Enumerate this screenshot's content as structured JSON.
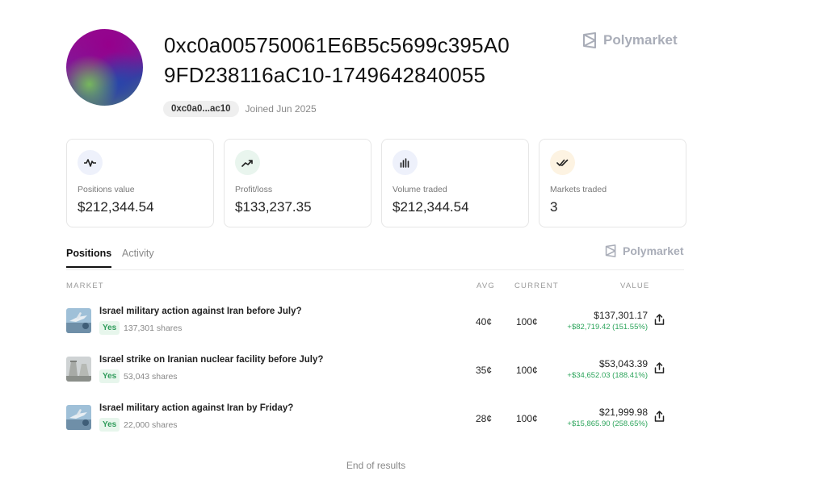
{
  "profile": {
    "name_line1": "0xc0a005750061E6B5c5699c395A0",
    "name_line2": "9FD238116aC10-1749642840055",
    "address_short": "0xc0a0...ac10",
    "joined": "Joined Jun 2025"
  },
  "brand": {
    "name": "Polymarket"
  },
  "stats": [
    {
      "label": "Positions value",
      "value": "$212,344.54",
      "icon": "pulse-icon",
      "color": "#eef1fb"
    },
    {
      "label": "Profit/loss",
      "value": "$133,237.35",
      "icon": "trend-up-icon",
      "color": "#e9f5ee"
    },
    {
      "label": "Volume traded",
      "value": "$212,344.54",
      "icon": "bar-chart-icon",
      "color": "#eef1fb"
    },
    {
      "label": "Markets traded",
      "value": "3",
      "icon": "double-check-icon",
      "color": "#fdf3e2"
    }
  ],
  "tabs": {
    "positions": "Positions",
    "activity": "Activity"
  },
  "table": {
    "headers": {
      "market": "MARKET",
      "avg": "AVG",
      "current": "CURRENT",
      "value": "VALUE"
    },
    "rows": [
      {
        "question": "Israel military action against Iran before July?",
        "outcome": "Yes",
        "shares": "137,301 shares",
        "avg": "40¢",
        "current": "100¢",
        "value": "$137,301.17",
        "pnl": "+$82,719.42 (151.55%)"
      },
      {
        "question": "Israel strike on Iranian nuclear facility before July?",
        "outcome": "Yes",
        "shares": "53,043 shares",
        "avg": "35¢",
        "current": "100¢",
        "value": "$53,043.39",
        "pnl": "+$34,652.03 (188.41%)"
      },
      {
        "question": "Israel military action against Iran by Friday?",
        "outcome": "Yes",
        "shares": "22,000 shares",
        "avg": "28¢",
        "current": "100¢",
        "value": "$21,999.98",
        "pnl": "+$15,865.90 (258.65%)"
      }
    ]
  },
  "footer": {
    "end_text": "End of results"
  },
  "colors": {
    "positive": "#2ea55c",
    "muted": "#888888",
    "brand_gray": "#a9adb8"
  }
}
